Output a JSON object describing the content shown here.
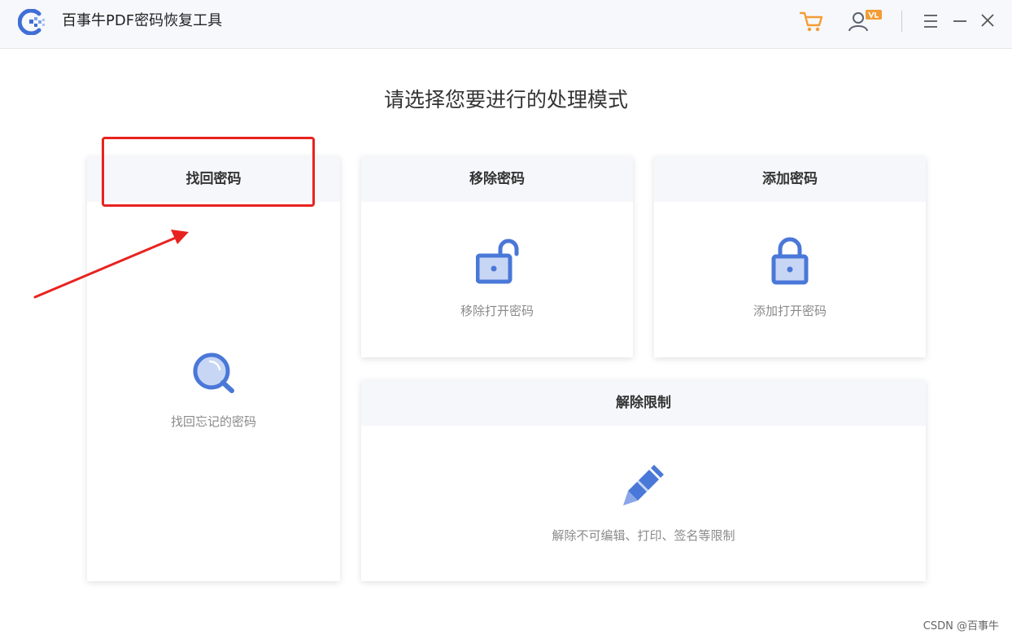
{
  "app": {
    "title": "百事牛PDF密码恢复工具",
    "logo_icon": "app-logo-icon"
  },
  "toolbar": {
    "cart_icon": "cart-icon",
    "account_icon": "user-vip-icon",
    "menu_icon": "menu-icon",
    "minimize_icon": "minimize-icon",
    "close_icon": "close-icon"
  },
  "heading": "请选择您要进行的处理模式",
  "modes": [
    {
      "title": "找回密码",
      "description": "找回忘记的密码",
      "icon": "search-icon"
    },
    {
      "title": "移除密码",
      "description": "移除打开密码",
      "icon": "unlock-icon"
    },
    {
      "title": "添加密码",
      "description": "添加打开密码",
      "icon": "lock-icon"
    },
    {
      "title": "解除限制",
      "description": "解除不可编辑、打印、签名等限制",
      "icon": "pencil-icon"
    }
  ],
  "colors": {
    "accent": "#4a78d8",
    "accent_light": "#c8d6f5",
    "cart": "#f39c36",
    "highlight": "#e8231f"
  },
  "watermark": "CSDN @百事牛"
}
